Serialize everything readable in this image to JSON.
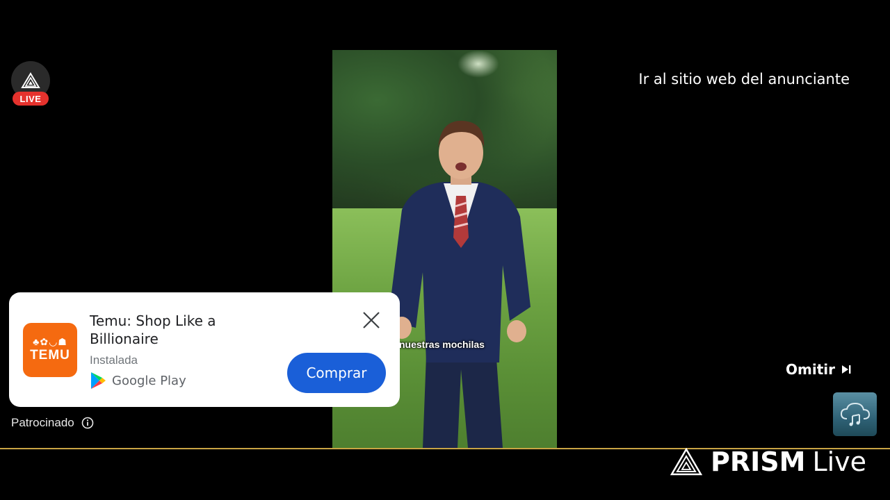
{
  "live_badge": {
    "label": "LIVE"
  },
  "advertiser_link": "Ir al sitio web del anunciante",
  "video": {
    "subtitle": "nuestras mochilas"
  },
  "ad_card": {
    "app_icon_text": "TEMU",
    "app_name": "Temu: Shop Like a Billionaire",
    "status": "Instalada",
    "store": "Google Play",
    "cta": "Comprar",
    "brand_color": "#f56a10",
    "cta_color": "#1a5fd8"
  },
  "sponsored": "Patrocinado",
  "skip": "Omitir",
  "watermark": {
    "name": "PRISM",
    "suffix": "Live"
  },
  "colors": {
    "live_red": "#e5322d",
    "accent_line": "#c9a544"
  }
}
